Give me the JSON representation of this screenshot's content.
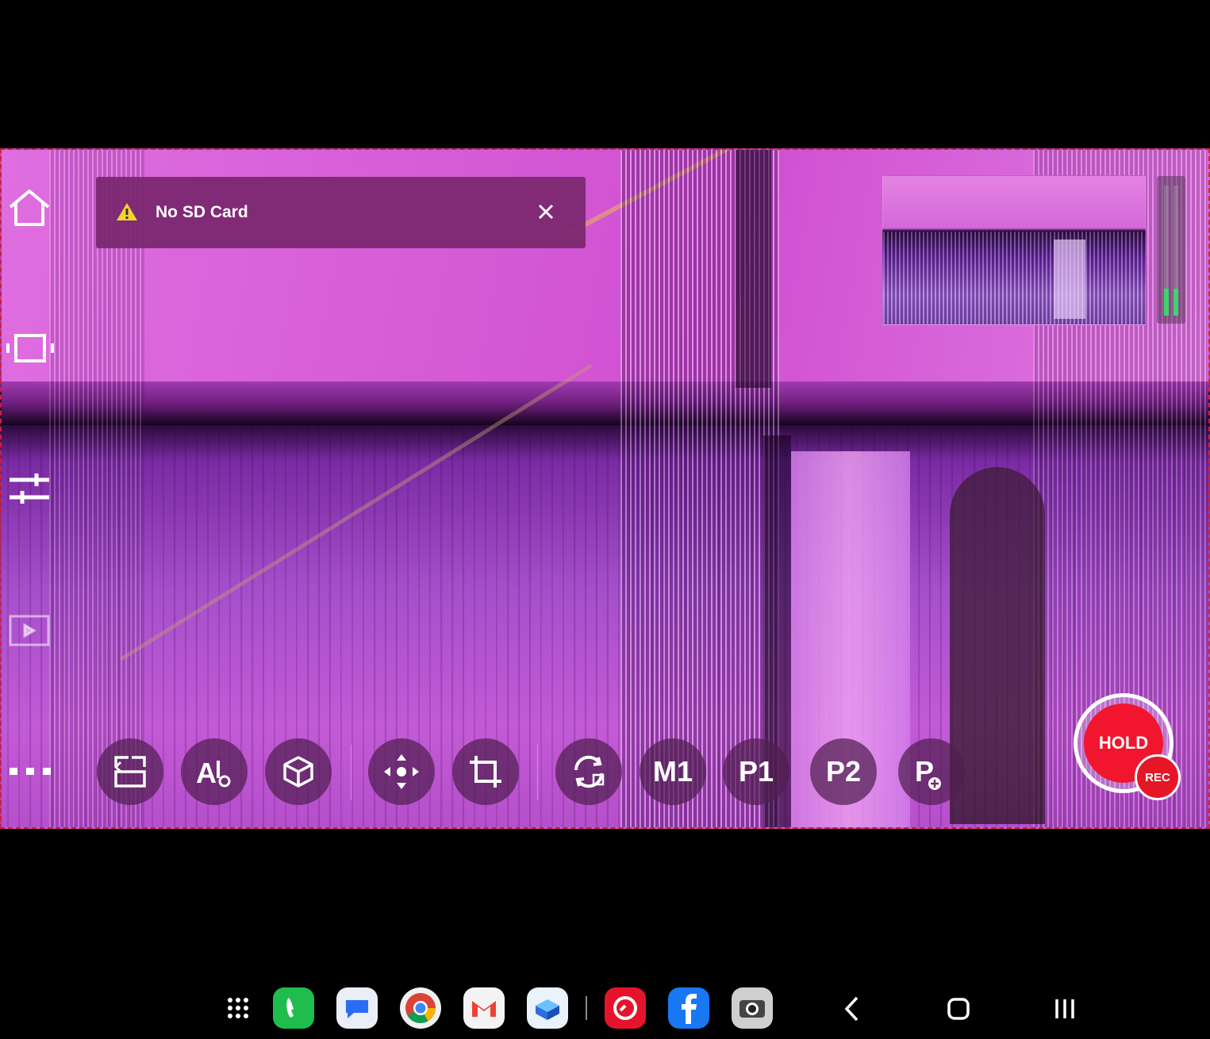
{
  "notification": {
    "text": "No SD Card",
    "icon": "warning-icon",
    "close_icon": "close-icon"
  },
  "left_rail": {
    "icons": [
      "home-icon",
      "fullscreen-icon",
      "sliders-icon",
      "playback-icon",
      "more-icon"
    ]
  },
  "toolbar": {
    "items": [
      {
        "name": "scene-switch-icon"
      },
      {
        "name": "ai-settings-icon"
      },
      {
        "name": "3d-cube-icon"
      },
      {
        "name": "move-icon"
      },
      {
        "name": "crop-icon"
      },
      {
        "name": "rotate-camera-icon"
      },
      {
        "label": "M1"
      },
      {
        "label": "P1"
      },
      {
        "label": "P2"
      },
      {
        "name": "add-preset-icon",
        "label": "P"
      }
    ]
  },
  "record": {
    "hold_label": "HOLD",
    "rec_label": "REC"
  },
  "taskbar": {
    "apps": [
      "apps-grid-icon",
      "phone-icon",
      "messages-icon",
      "chrome-icon",
      "gmail-icon",
      "files-icon",
      "cast-app-icon",
      "facebook-icon",
      "camera-icon"
    ],
    "nav": [
      "back-icon",
      "home-nav-icon",
      "recents-icon"
    ]
  },
  "colors": {
    "accent_red": "#f2152e",
    "overlay_purple": "#7a266e",
    "meter_green": "#3fd46a",
    "warn_yellow": "#f6d32d"
  }
}
